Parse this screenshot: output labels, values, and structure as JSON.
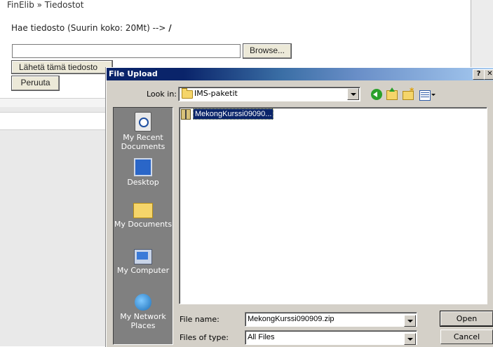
{
  "page": {
    "breadcrumb": "FinElib » Tiedostot",
    "prompt": "Hae tiedosto (Suurin koko: 20Mt) -->",
    "prompt_slash": "/",
    "browse_label": "Browse...",
    "send_label": "Lähetä tämä tiedosto",
    "cancel_label": "Peruuta"
  },
  "dialog": {
    "title": "File Upload",
    "help_label": "?",
    "close_label": "✕",
    "lookin_label": "Look in:",
    "lookin_value": "IMS-paketit",
    "places": [
      {
        "label_line1": "My Recent",
        "label_line2": "Documents",
        "icon": "recent-documents-icon"
      },
      {
        "label_line1": "Desktop",
        "label_line2": "",
        "icon": "desktop-icon"
      },
      {
        "label_line1": "My Documents",
        "label_line2": "",
        "icon": "my-documents-icon"
      },
      {
        "label_line1": "My Computer",
        "label_line2": "",
        "icon": "my-computer-icon"
      },
      {
        "label_line1": "My Network",
        "label_line2": "Places",
        "icon": "network-places-icon"
      }
    ],
    "files": [
      {
        "name": "MekongKurssi09090...",
        "icon": "zip-file-icon"
      }
    ],
    "filename_label": "File name:",
    "filename_value": "MekongKurssi090909.zip",
    "filetype_label": "Files of type:",
    "filetype_value": "All Files",
    "open_label": "Open",
    "cancel_label": "Cancel"
  }
}
